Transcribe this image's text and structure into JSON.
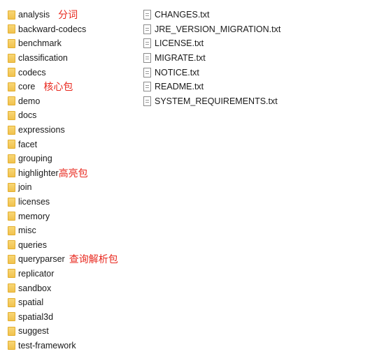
{
  "folders": [
    {
      "name": "analysis",
      "note": "分词"
    },
    {
      "name": "backward-codecs"
    },
    {
      "name": "benchmark"
    },
    {
      "name": "classification"
    },
    {
      "name": "codecs"
    },
    {
      "name": "core",
      "note": "核心包"
    },
    {
      "name": "demo"
    },
    {
      "name": "docs"
    },
    {
      "name": "expressions"
    },
    {
      "name": "facet"
    },
    {
      "name": "grouping"
    },
    {
      "name": "highlighter",
      "note": "高亮包"
    },
    {
      "name": "join"
    },
    {
      "name": "licenses"
    },
    {
      "name": "memory"
    },
    {
      "name": "misc"
    },
    {
      "name": "queries"
    },
    {
      "name": "queryparser",
      "note": "查询解析包"
    },
    {
      "name": "replicator"
    },
    {
      "name": "sandbox"
    },
    {
      "name": "spatial"
    },
    {
      "name": "spatial3d"
    },
    {
      "name": "suggest"
    },
    {
      "name": "test-framework"
    }
  ],
  "files": [
    "CHANGES.txt",
    "JRE_VERSION_MIGRATION.txt",
    "LICENSE.txt",
    "MIGRATE.txt",
    "NOTICE.txt",
    "README.txt",
    "SYSTEM_REQUIREMENTS.txt"
  ]
}
